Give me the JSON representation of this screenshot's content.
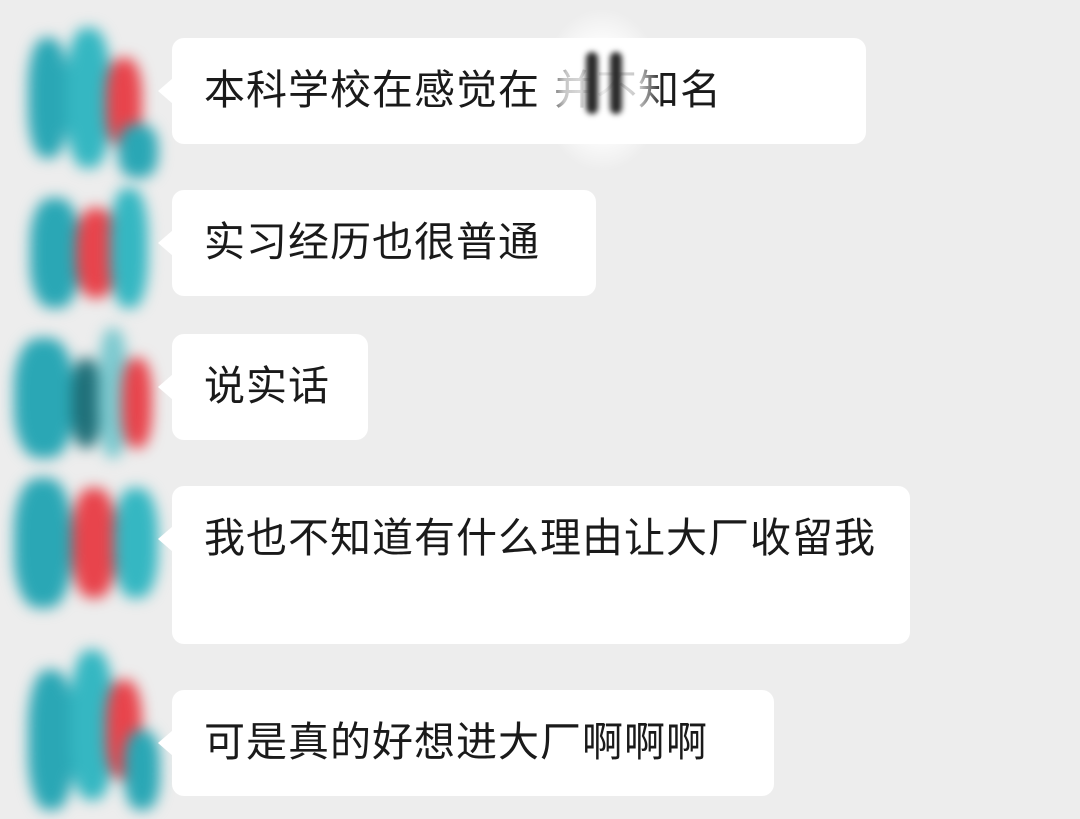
{
  "messages": [
    {
      "text": "本科学校在感觉在 并不知名"
    },
    {
      "text": "实习经历也很普通"
    },
    {
      "text": "说实话"
    },
    {
      "text": "我也不知道有什么理由让大厂收留我"
    },
    {
      "text": "可是真的好想进大厂啊啊啊"
    }
  ],
  "colors": {
    "background": "#ededed",
    "bubble": "#ffffff",
    "text": "#1a1a1a",
    "avatar_teal": "#2aa7b5",
    "avatar_red": "#e8444c"
  }
}
